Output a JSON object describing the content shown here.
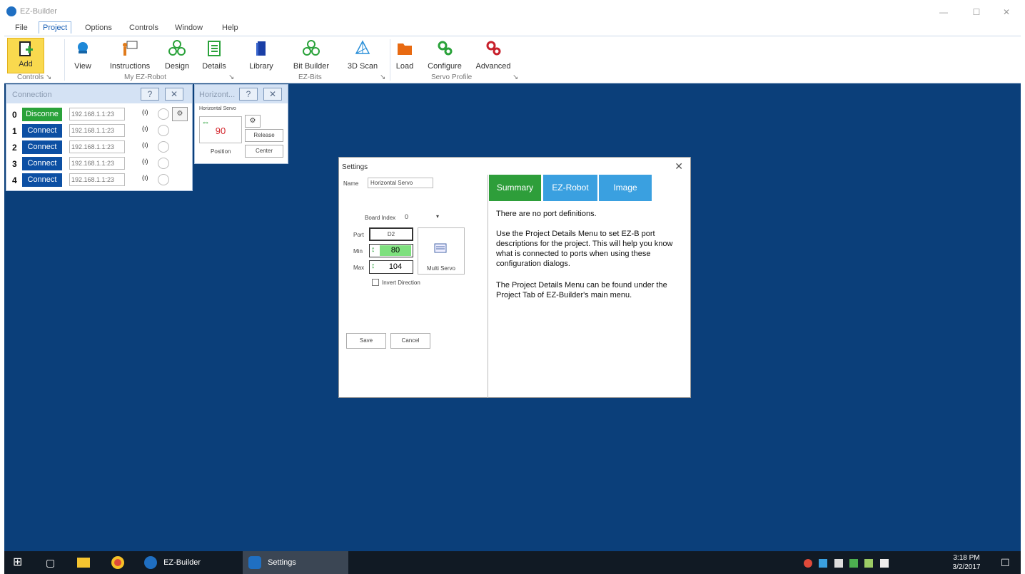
{
  "window": {
    "title": "EZ-Builder",
    "minimize": "—",
    "maximize": "☐",
    "close": "✕"
  },
  "menu": [
    "File",
    "Project",
    "Options",
    "Controls",
    "Window",
    "Help"
  ],
  "ribbon": {
    "buttons": [
      "Add",
      "View",
      "Instructions",
      "Design",
      "Details",
      "Library",
      "Bit Builder",
      "3D Scan",
      "Load",
      "Configure",
      "Advanced"
    ],
    "groups": [
      "Controls",
      "My EZ-Robot",
      "EZ-Bits",
      "Servo Profile"
    ],
    "expand_glyph": "↘"
  },
  "connection_panel": {
    "title": "Connection",
    "help": "?",
    "close": "✕",
    "rows": [
      {
        "index": "0",
        "button": "Disconne",
        "ip": "192.168.1.1:23",
        "color": "#2aa23a"
      },
      {
        "index": "1",
        "button": "Connect",
        "ip": "192.168.1.1:23",
        "color": "#0c4fa3"
      },
      {
        "index": "2",
        "button": "Connect",
        "ip": "192.168.1.1:23",
        "color": "#0c4fa3"
      },
      {
        "index": "3",
        "button": "Connect",
        "ip": "192.168.1.1:23",
        "color": "#0c4fa3"
      },
      {
        "index": "4",
        "button": "Connect",
        "ip": "192.168.1.1:23",
        "color": "#0c4fa3"
      }
    ],
    "wifi_glyph": "(ı)",
    "gear_glyph": "⚙"
  },
  "servo_panel": {
    "title": "Horizont...",
    "help": "?",
    "close": "✕",
    "subtitle": "Horizontal Servo",
    "value": "90",
    "position_label": "Position",
    "release": "Release",
    "center": "Center",
    "gear_glyph": "⚙",
    "arrows_glyph": "⇔"
  },
  "settings": {
    "title": "Settings",
    "close": "✕",
    "name_label": "Name",
    "name_value": "Horizontal Servo",
    "board_index_label": "Board Index",
    "board_index_value": "0",
    "board_index_arrow": "▾",
    "port_label": "Port",
    "port_value": "D2",
    "min_label": "Min",
    "min_value": "80",
    "max_label": "Max",
    "max_value": "104",
    "multi_servo": "Multi Servo",
    "invert_label": "Invert Direction",
    "save": "Save",
    "cancel": "Cancel",
    "tabs": [
      {
        "label": "Summary",
        "color": "#2e9e3a"
      },
      {
        "label": "EZ-Robot",
        "color": "#3aa0e0"
      },
      {
        "label": "Image",
        "color": "#3aa0e0"
      }
    ],
    "info1": "There are no port definitions.",
    "info2": "Use the Project Details Menu to set EZ-B port descriptions for the project. This will help you know what is connected to ports when using these configuration dialogs.",
    "info3": "The Project Details Menu can be found under the Project Tab of EZ-Builder's main menu."
  },
  "taskbar": {
    "start_glyph": "⊞",
    "task_view_glyph": "▢",
    "apps": [
      "EZ-Builder",
      "Settings"
    ],
    "time": "3:18 PM",
    "date": "3/2/2017",
    "notification_glyph": "☐"
  }
}
